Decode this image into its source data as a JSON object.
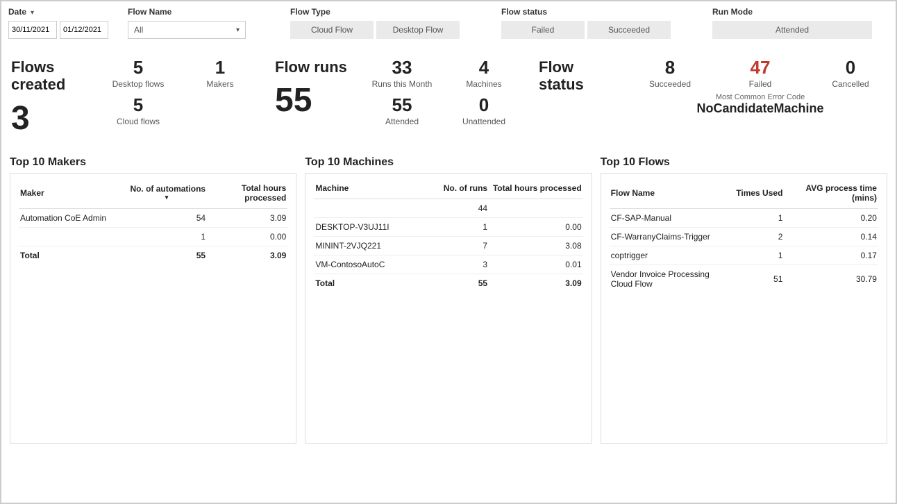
{
  "filters": {
    "date_label": "Date",
    "date_from": "30/11/2021",
    "date_to": "01/12/2021",
    "flowname_label": "Flow Name",
    "flowname_value": "All",
    "flowtype_label": "Flow Type",
    "flowtype_options": [
      "Cloud Flow",
      "Desktop Flow"
    ],
    "flowstatus_label": "Flow status",
    "flowstatus_options": [
      "Failed",
      "Succeeded"
    ],
    "runmode_label": "Run Mode",
    "runmode_options": [
      "Attended"
    ]
  },
  "stats": {
    "flows_created": {
      "title": "Flows created",
      "total": "3",
      "desktop_flows": {
        "value": "5",
        "label": "Desktop flows"
      },
      "cloud_flows": {
        "value": "5",
        "label": "Cloud flows"
      },
      "makers": {
        "value": "1",
        "label": "Makers"
      }
    },
    "flow_runs": {
      "title": "Flow runs",
      "total": "55",
      "runs_month": {
        "value": "33",
        "label": "Runs this Month"
      },
      "attended": {
        "value": "55",
        "label": "Attended"
      },
      "machines": {
        "value": "4",
        "label": "Machines"
      },
      "unattended": {
        "value": "0",
        "label": "Unattended"
      }
    },
    "flow_status": {
      "title": "Flow status",
      "succeeded": {
        "value": "8",
        "label": "Succeeded"
      },
      "failed": {
        "value": "47",
        "label": "Failed"
      },
      "cancelled": {
        "value": "0",
        "label": "Cancelled"
      },
      "error_label": "Most Common Error Code",
      "error_code": "NoCandidateMachine"
    }
  },
  "makers_table": {
    "title": "Top 10 Makers",
    "headers": {
      "maker": "Maker",
      "automations": "No. of automations",
      "hours": "Total hours processed"
    },
    "rows": [
      {
        "maker": "Automation CoE Admin",
        "automations": "54",
        "hours": "3.09"
      },
      {
        "maker": "",
        "automations": "1",
        "hours": "0.00"
      }
    ],
    "total": {
      "label": "Total",
      "automations": "55",
      "hours": "3.09"
    }
  },
  "machines_table": {
    "title": "Top 10 Machines",
    "headers": {
      "machine": "Machine",
      "runs": "No. of runs",
      "hours": "Total hours processed"
    },
    "rows": [
      {
        "machine": "",
        "runs": "44",
        "hours": ""
      },
      {
        "machine": "DESKTOP-V3UJ11I",
        "runs": "1",
        "hours": "0.00"
      },
      {
        "machine": "MININT-2VJQ221",
        "runs": "7",
        "hours": "3.08"
      },
      {
        "machine": "VM-ContosoAutoC",
        "runs": "3",
        "hours": "0.01"
      }
    ],
    "total": {
      "label": "Total",
      "runs": "55",
      "hours": "3.09"
    }
  },
  "flows_table": {
    "title": "Top 10 Flows",
    "headers": {
      "flow": "Flow Name",
      "times": "Times Used",
      "avg": "AVG process time (mins)"
    },
    "rows": [
      {
        "flow": "CF-SAP-Manual",
        "times": "1",
        "avg": "0.20"
      },
      {
        "flow": "CF-WarranyClaims-Trigger",
        "times": "2",
        "avg": "0.14"
      },
      {
        "flow": "coptrigger",
        "times": "1",
        "avg": "0.17"
      },
      {
        "flow": "Vendor Invoice Processing Cloud Flow",
        "times": "51",
        "avg": "30.79"
      }
    ]
  }
}
